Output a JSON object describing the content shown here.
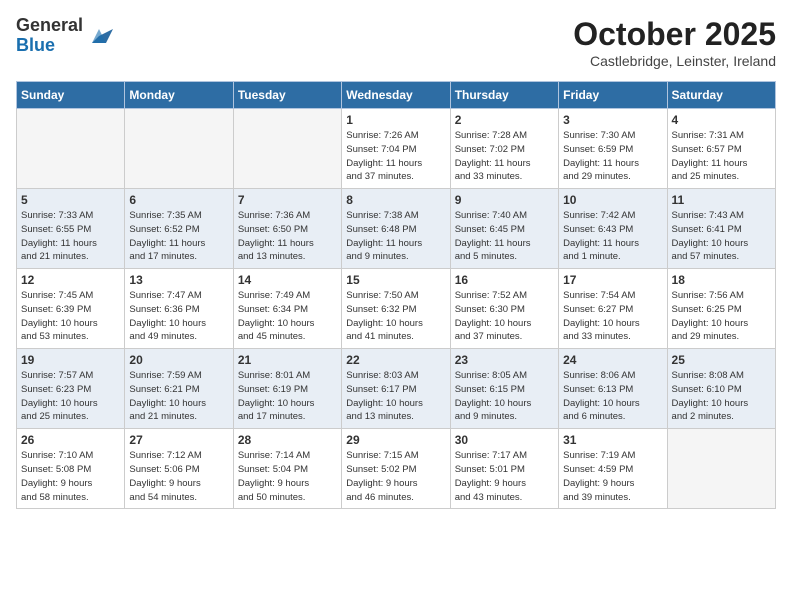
{
  "logo": {
    "general": "General",
    "blue": "Blue"
  },
  "title": "October 2025",
  "subtitle": "Castlebridge, Leinster, Ireland",
  "headers": [
    "Sunday",
    "Monday",
    "Tuesday",
    "Wednesday",
    "Thursday",
    "Friday",
    "Saturday"
  ],
  "weeks": [
    [
      {
        "day": "",
        "info": ""
      },
      {
        "day": "",
        "info": ""
      },
      {
        "day": "",
        "info": ""
      },
      {
        "day": "1",
        "info": "Sunrise: 7:26 AM\nSunset: 7:04 PM\nDaylight: 11 hours\nand 37 minutes."
      },
      {
        "day": "2",
        "info": "Sunrise: 7:28 AM\nSunset: 7:02 PM\nDaylight: 11 hours\nand 33 minutes."
      },
      {
        "day": "3",
        "info": "Sunrise: 7:30 AM\nSunset: 6:59 PM\nDaylight: 11 hours\nand 29 minutes."
      },
      {
        "day": "4",
        "info": "Sunrise: 7:31 AM\nSunset: 6:57 PM\nDaylight: 11 hours\nand 25 minutes."
      }
    ],
    [
      {
        "day": "5",
        "info": "Sunrise: 7:33 AM\nSunset: 6:55 PM\nDaylight: 11 hours\nand 21 minutes."
      },
      {
        "day": "6",
        "info": "Sunrise: 7:35 AM\nSunset: 6:52 PM\nDaylight: 11 hours\nand 17 minutes."
      },
      {
        "day": "7",
        "info": "Sunrise: 7:36 AM\nSunset: 6:50 PM\nDaylight: 11 hours\nand 13 minutes."
      },
      {
        "day": "8",
        "info": "Sunrise: 7:38 AM\nSunset: 6:48 PM\nDaylight: 11 hours\nand 9 minutes."
      },
      {
        "day": "9",
        "info": "Sunrise: 7:40 AM\nSunset: 6:45 PM\nDaylight: 11 hours\nand 5 minutes."
      },
      {
        "day": "10",
        "info": "Sunrise: 7:42 AM\nSunset: 6:43 PM\nDaylight: 11 hours\nand 1 minute."
      },
      {
        "day": "11",
        "info": "Sunrise: 7:43 AM\nSunset: 6:41 PM\nDaylight: 10 hours\nand 57 minutes."
      }
    ],
    [
      {
        "day": "12",
        "info": "Sunrise: 7:45 AM\nSunset: 6:39 PM\nDaylight: 10 hours\nand 53 minutes."
      },
      {
        "day": "13",
        "info": "Sunrise: 7:47 AM\nSunset: 6:36 PM\nDaylight: 10 hours\nand 49 minutes."
      },
      {
        "day": "14",
        "info": "Sunrise: 7:49 AM\nSunset: 6:34 PM\nDaylight: 10 hours\nand 45 minutes."
      },
      {
        "day": "15",
        "info": "Sunrise: 7:50 AM\nSunset: 6:32 PM\nDaylight: 10 hours\nand 41 minutes."
      },
      {
        "day": "16",
        "info": "Sunrise: 7:52 AM\nSunset: 6:30 PM\nDaylight: 10 hours\nand 37 minutes."
      },
      {
        "day": "17",
        "info": "Sunrise: 7:54 AM\nSunset: 6:27 PM\nDaylight: 10 hours\nand 33 minutes."
      },
      {
        "day": "18",
        "info": "Sunrise: 7:56 AM\nSunset: 6:25 PM\nDaylight: 10 hours\nand 29 minutes."
      }
    ],
    [
      {
        "day": "19",
        "info": "Sunrise: 7:57 AM\nSunset: 6:23 PM\nDaylight: 10 hours\nand 25 minutes."
      },
      {
        "day": "20",
        "info": "Sunrise: 7:59 AM\nSunset: 6:21 PM\nDaylight: 10 hours\nand 21 minutes."
      },
      {
        "day": "21",
        "info": "Sunrise: 8:01 AM\nSunset: 6:19 PM\nDaylight: 10 hours\nand 17 minutes."
      },
      {
        "day": "22",
        "info": "Sunrise: 8:03 AM\nSunset: 6:17 PM\nDaylight: 10 hours\nand 13 minutes."
      },
      {
        "day": "23",
        "info": "Sunrise: 8:05 AM\nSunset: 6:15 PM\nDaylight: 10 hours\nand 9 minutes."
      },
      {
        "day": "24",
        "info": "Sunrise: 8:06 AM\nSunset: 6:13 PM\nDaylight: 10 hours\nand 6 minutes."
      },
      {
        "day": "25",
        "info": "Sunrise: 8:08 AM\nSunset: 6:10 PM\nDaylight: 10 hours\nand 2 minutes."
      }
    ],
    [
      {
        "day": "26",
        "info": "Sunrise: 7:10 AM\nSunset: 5:08 PM\nDaylight: 9 hours\nand 58 minutes."
      },
      {
        "day": "27",
        "info": "Sunrise: 7:12 AM\nSunset: 5:06 PM\nDaylight: 9 hours\nand 54 minutes."
      },
      {
        "day": "28",
        "info": "Sunrise: 7:14 AM\nSunset: 5:04 PM\nDaylight: 9 hours\nand 50 minutes."
      },
      {
        "day": "29",
        "info": "Sunrise: 7:15 AM\nSunset: 5:02 PM\nDaylight: 9 hours\nand 46 minutes."
      },
      {
        "day": "30",
        "info": "Sunrise: 7:17 AM\nSunset: 5:01 PM\nDaylight: 9 hours\nand 43 minutes."
      },
      {
        "day": "31",
        "info": "Sunrise: 7:19 AM\nSunset: 4:59 PM\nDaylight: 9 hours\nand 39 minutes."
      },
      {
        "day": "",
        "info": ""
      }
    ]
  ]
}
